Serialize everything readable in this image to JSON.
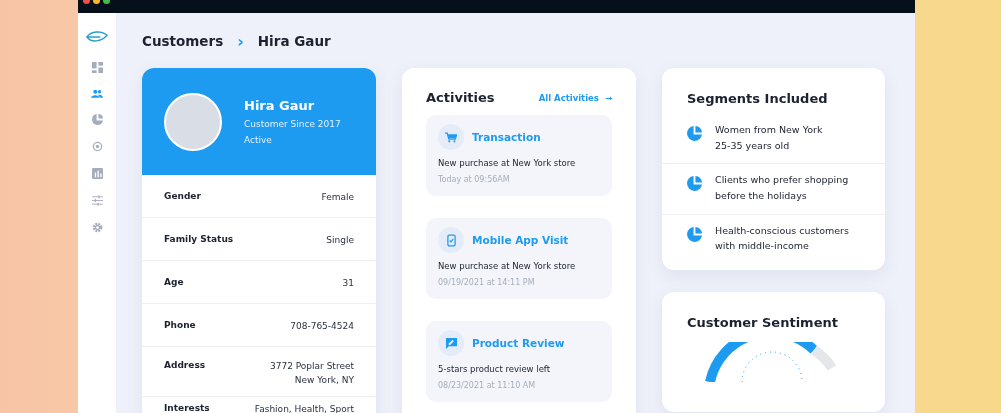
{
  "breadcrumb": {
    "parent": "Customers",
    "separator": "›",
    "current": "Hira Gaur"
  },
  "sidebar": {
    "items": [
      {
        "kind": "grid",
        "selected": false
      },
      {
        "kind": "users",
        "selected": true
      },
      {
        "kind": "pie",
        "selected": false
      },
      {
        "kind": "target",
        "selected": false
      },
      {
        "kind": "chart",
        "selected": false
      },
      {
        "kind": "sliders",
        "selected": false
      },
      {
        "kind": "gear",
        "selected": false
      }
    ]
  },
  "profile": {
    "name": "Hira Gaur",
    "since": "Customer Since 2017",
    "status": "Active",
    "fields": [
      {
        "label": "Gender",
        "value": [
          "Female"
        ]
      },
      {
        "label": "Family Status",
        "value": [
          "Single"
        ]
      },
      {
        "label": "Age",
        "value": [
          "31"
        ]
      },
      {
        "label": "Phone",
        "value": [
          "708-765-4524"
        ]
      },
      {
        "label": "Address",
        "value": [
          "3772 Poplar Street",
          "New York, NY"
        ]
      },
      {
        "label": "Interests",
        "value": [
          "Fashion, Health, Sport"
        ]
      }
    ]
  },
  "activities": {
    "title": "Activities",
    "link": "All Activities",
    "link_arrow": "→",
    "items": [
      {
        "kind": "cart",
        "title": "Transaction",
        "text": "New purchase at New York store",
        "time": "Today at 09:56AM"
      },
      {
        "kind": "phone",
        "title": "Mobile App Visit",
        "text": "New purchase at New York store",
        "time": "09/19/2021 at 14:11 PM"
      },
      {
        "kind": "review",
        "title": "Product Review",
        "text": "5-stars product review left",
        "time": "08/23/2021 at 11:10 AM"
      }
    ]
  },
  "segments": {
    "title": "Segments Included",
    "items": [
      [
        "Women from New York",
        "25-35 years old"
      ],
      [
        "Clients who prefer shopping",
        "before the holidays"
      ],
      [
        "Health-conscious customers",
        "with middle-income"
      ]
    ]
  },
  "sentiment": {
    "title": "Customer Sentiment"
  }
}
